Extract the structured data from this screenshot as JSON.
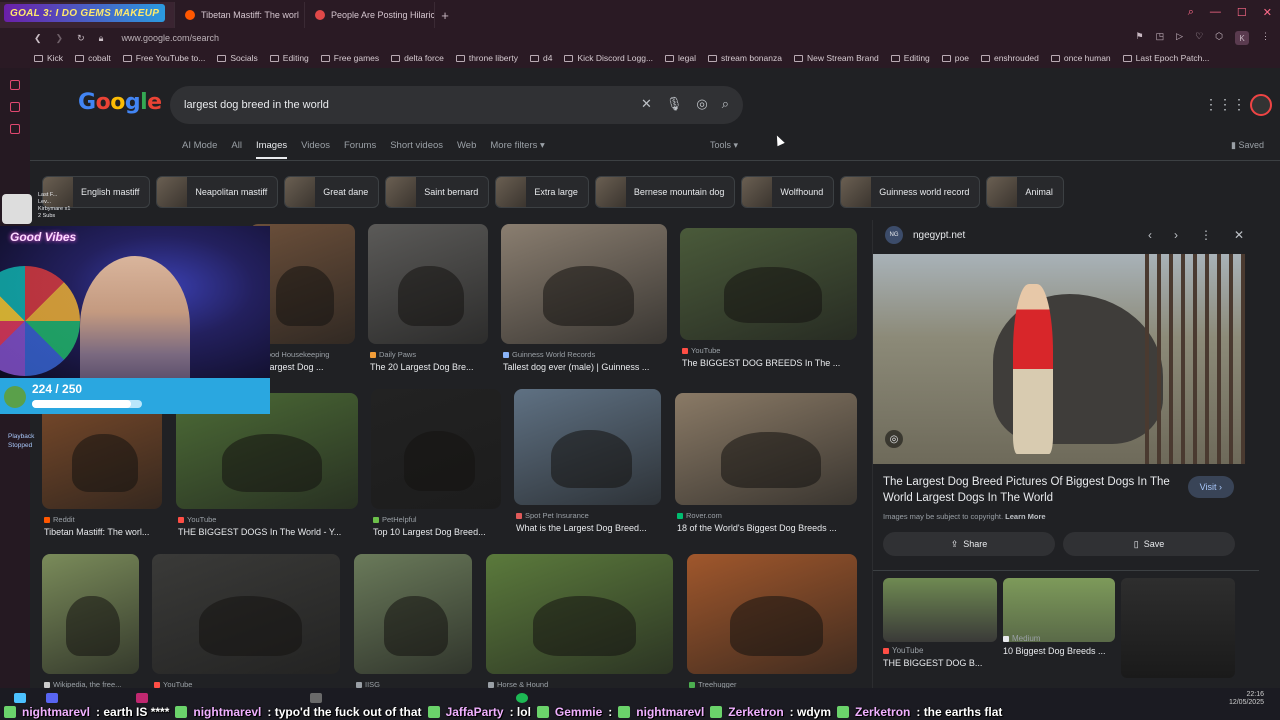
{
  "overlay": {
    "goal_banner": "GOAL 3: I DO GEMS MAKEUP",
    "good_vibes": "Good Vibes",
    "hud_stats": [
      "Last F...",
      "Lev...",
      "Kirbymare x1",
      "2 Subs"
    ],
    "goal_count": "224 / 250",
    "goal_progress": 0.896,
    "playback": [
      "Playback",
      "Stopped"
    ]
  },
  "browser": {
    "tabs": [
      {
        "title": "",
        "active": true
      },
      {
        "title": "Tibetan Mastiff: The worl",
        "active": false
      },
      {
        "title": "People Are Posting Hilaric",
        "active": false
      }
    ],
    "url": "www.google.com/search",
    "profile_letter": "K",
    "bookmarks": [
      "Kick",
      "cobalt",
      "Free YouTube to...",
      "Socials",
      "Editing",
      "Free games",
      "delta force",
      "throne liberty",
      "d4",
      "Kick Discord Logg...",
      "legal",
      "stream bonanza",
      "New Stream Brand",
      "Editing",
      "poe",
      "enshrouded",
      "once human",
      "Last Epoch Patch..."
    ]
  },
  "google": {
    "logo_letters": [
      "G",
      "o",
      "o",
      "g",
      "l",
      "e"
    ],
    "logo_colors": [
      "#4285f4",
      "#ea4335",
      "#fbbc05",
      "#4285f4",
      "#34a853",
      "#ea4335"
    ],
    "query": "largest dog breed in the world",
    "nav_tabs": [
      "AI Mode",
      "All",
      "Images",
      "Videos",
      "Forums",
      "Short videos",
      "Web",
      "More filters ▾"
    ],
    "active_tab": "Images",
    "tools": "Tools ▾",
    "saved": "Saved",
    "chips": [
      "English mastiff",
      "Neapolitan mastiff",
      "Great dane",
      "Saint bernard",
      "Extra large",
      "Bernese mountain dog",
      "Wolfhound",
      "Guinness world record",
      "Animal"
    ]
  },
  "results": [
    {
      "source": "Good Housekeeping",
      "title": "40 Largest Dog ...",
      "color": "#6b4f3a",
      "src_color": "#e0703a"
    },
    {
      "source": "Daily Paws",
      "title": "The 20 Largest Dog Bre...",
      "color": "#5b5a58",
      "src_color": "#f29d38"
    },
    {
      "source": "Guinness World Records",
      "title": "Tallest dog ever (male) | Guinness ...",
      "color": "#8a7e70",
      "src_color": "#8ab4f8"
    },
    {
      "source": "YouTube",
      "title": "The BIGGEST DOG BREEDS In The ...",
      "color": "#4a5a3a",
      "src_color": "#ff4e45"
    },
    {
      "source": "Reddit",
      "title": "Tibetan Mastiff: The worl...",
      "color": "#7a4a2a",
      "src_color": "#ff5700"
    },
    {
      "source": "YouTube",
      "title": "THE BIGGEST DOGS In The World - Y...",
      "color": "#4c6b36",
      "src_color": "#ff4e45"
    },
    {
      "source": "PetHelpful",
      "title": "Top 10 Largest Dog Breed...",
      "color": "#222222",
      "src_color": "#6cc04a"
    },
    {
      "source": "Spot Pet Insurance",
      "title": "What is the Largest Dog Breed...",
      "color": "#5f7183",
      "src_color": "#e05a5a"
    },
    {
      "source": "Rover.com",
      "title": "18 of the World's Biggest Dog Breeds ...",
      "color": "#8a7a66",
      "src_color": "#00bd70"
    },
    {
      "source": "Wikipedia, the free...",
      "title": "",
      "color": "#7a8b5a",
      "src_color": "#cccccc"
    },
    {
      "source": "YouTube",
      "title": "",
      "color": "#3a3a38",
      "src_color": "#ff4e45"
    },
    {
      "source": "IISG",
      "title": "",
      "color": "#6a7a5a",
      "src_color": "#9aa0a6"
    },
    {
      "source": "Horse & Hound",
      "title": "",
      "color": "#5b7a3c",
      "src_color": "#9aa0a6"
    },
    {
      "source": "Treehugger",
      "title": "",
      "color": "#a0572c",
      "src_color": "#4caf50"
    }
  ],
  "panel": {
    "site": "ngegypt.net",
    "site_favicon": "NG",
    "title": "The Largest Dog Breed Pictures Of Biggest Dogs In The World Largest Dogs In The World",
    "visit": "Visit",
    "copyright": "Images may be subject to copyright.",
    "learn_more": "Learn More",
    "share": "Share",
    "save": "Save",
    "related": [
      {
        "source": "YouTube",
        "title": "THE BIGGEST DOG B..."
      },
      {
        "source": "Medium",
        "title": "10 Biggest Dog Breeds ..."
      },
      {
        "source": "",
        "title": ""
      }
    ]
  },
  "taskbar": {
    "time": "22:16",
    "date": "12/05/2025"
  },
  "chat": [
    {
      "user": "nightmarevl",
      "msg": ": earth IS ****"
    },
    {
      "user": "nightmarevl",
      "msg": ": typo'd the fuck out of that"
    },
    {
      "user": "JaffaParty",
      "msg": ": lol"
    },
    {
      "user": "Gemmie",
      "msg": ":"
    },
    {
      "user": "nightmarevl",
      "msg": ""
    },
    {
      "user": "Zerketron",
      "msg": ": wdym"
    },
    {
      "user": "Zerketron",
      "msg": ": the earths flat"
    }
  ]
}
